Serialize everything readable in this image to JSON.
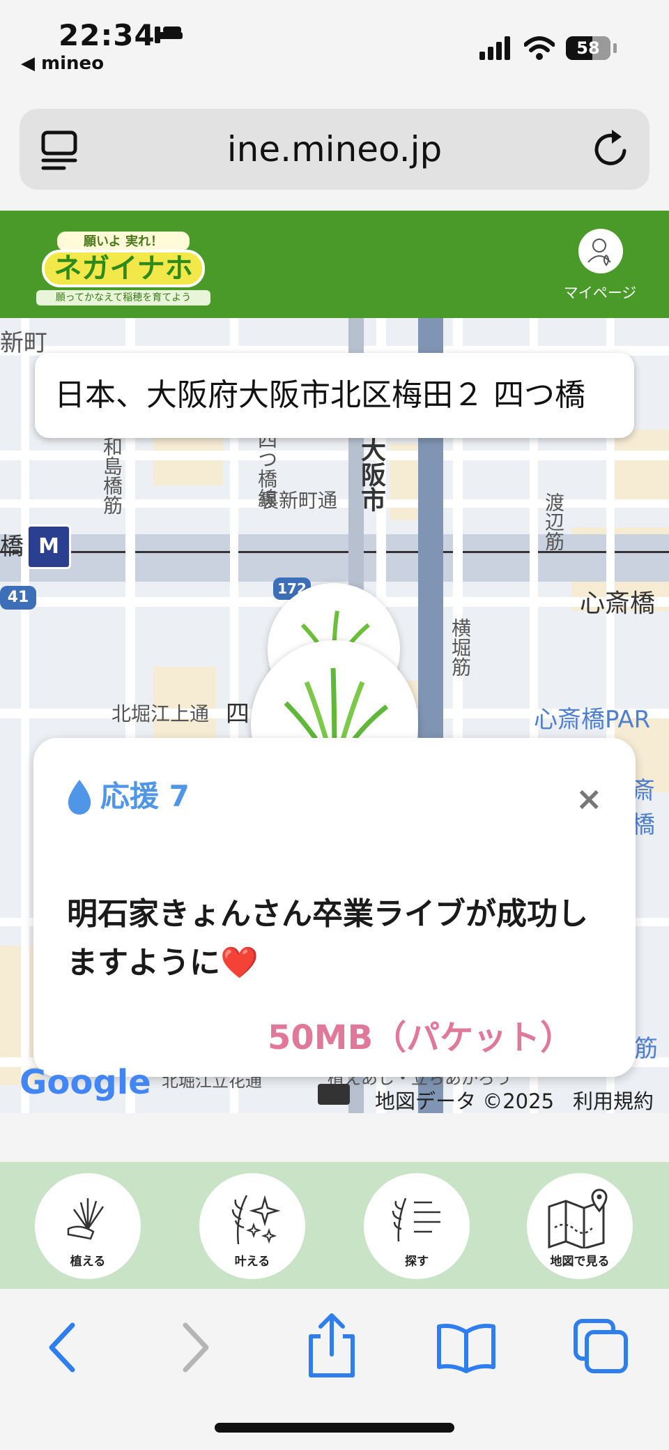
{
  "status": {
    "time": "22:34",
    "back_label": "◀ mineo",
    "battery": "58"
  },
  "browser": {
    "url": "ine.mineo.jp"
  },
  "header": {
    "logo_top": "願いよ 実れ！",
    "logo_main": "ネガイナホ",
    "logo_sub": "願ってかなえて稲穂を育てよう",
    "mypage_label": "マイページ"
  },
  "map": {
    "address": "日本、大阪府大阪市北区梅田２ 四つ橋",
    "labels": {
      "shinmachi": "新町",
      "wajimabashi": "和島橋筋",
      "yotsu": "四つ橋線",
      "urashinmachi": "裏新町通",
      "osaka": "大阪市",
      "watanabe": "渡辺筋",
      "hashi": "橋",
      "route41": "41",
      "route172": "172",
      "shinsaibashi": "心斎橋",
      "yokobori": "横堀筋",
      "kitahorie": "北堀江上通",
      "yotsu2": "四",
      "shinsaibashi_park": "心斎橋PAR",
      "shinsaibashi_suji": "斎橋",
      "bottom_right": "筋",
      "bottom_mid": "植えあし・立ちあがろう",
      "bottom_left": "北堀江立花通"
    },
    "google": "Google",
    "map_data": "地図データ ©2025",
    "terms": "利用規約"
  },
  "popup": {
    "support_label": "応援 7",
    "close_label": "×",
    "wish_text": "明石家きょんさん卒業ライブが成功しますように❤️",
    "reward": "50MB（パケット）"
  },
  "tabs": [
    {
      "label": "植える",
      "icon": "planting-icon"
    },
    {
      "label": "叶える",
      "icon": "grant-icon"
    },
    {
      "label": "探す",
      "icon": "search-list-icon"
    },
    {
      "label": "地図で見る",
      "icon": "map-icon"
    }
  ],
  "colors": {
    "header_green": "#4a9a2a",
    "support_blue": "#4f96e8",
    "reward_pink": "#e0789a",
    "tab_bg": "#c8e3c5",
    "toolbar_blue": "#2f7ef0"
  }
}
